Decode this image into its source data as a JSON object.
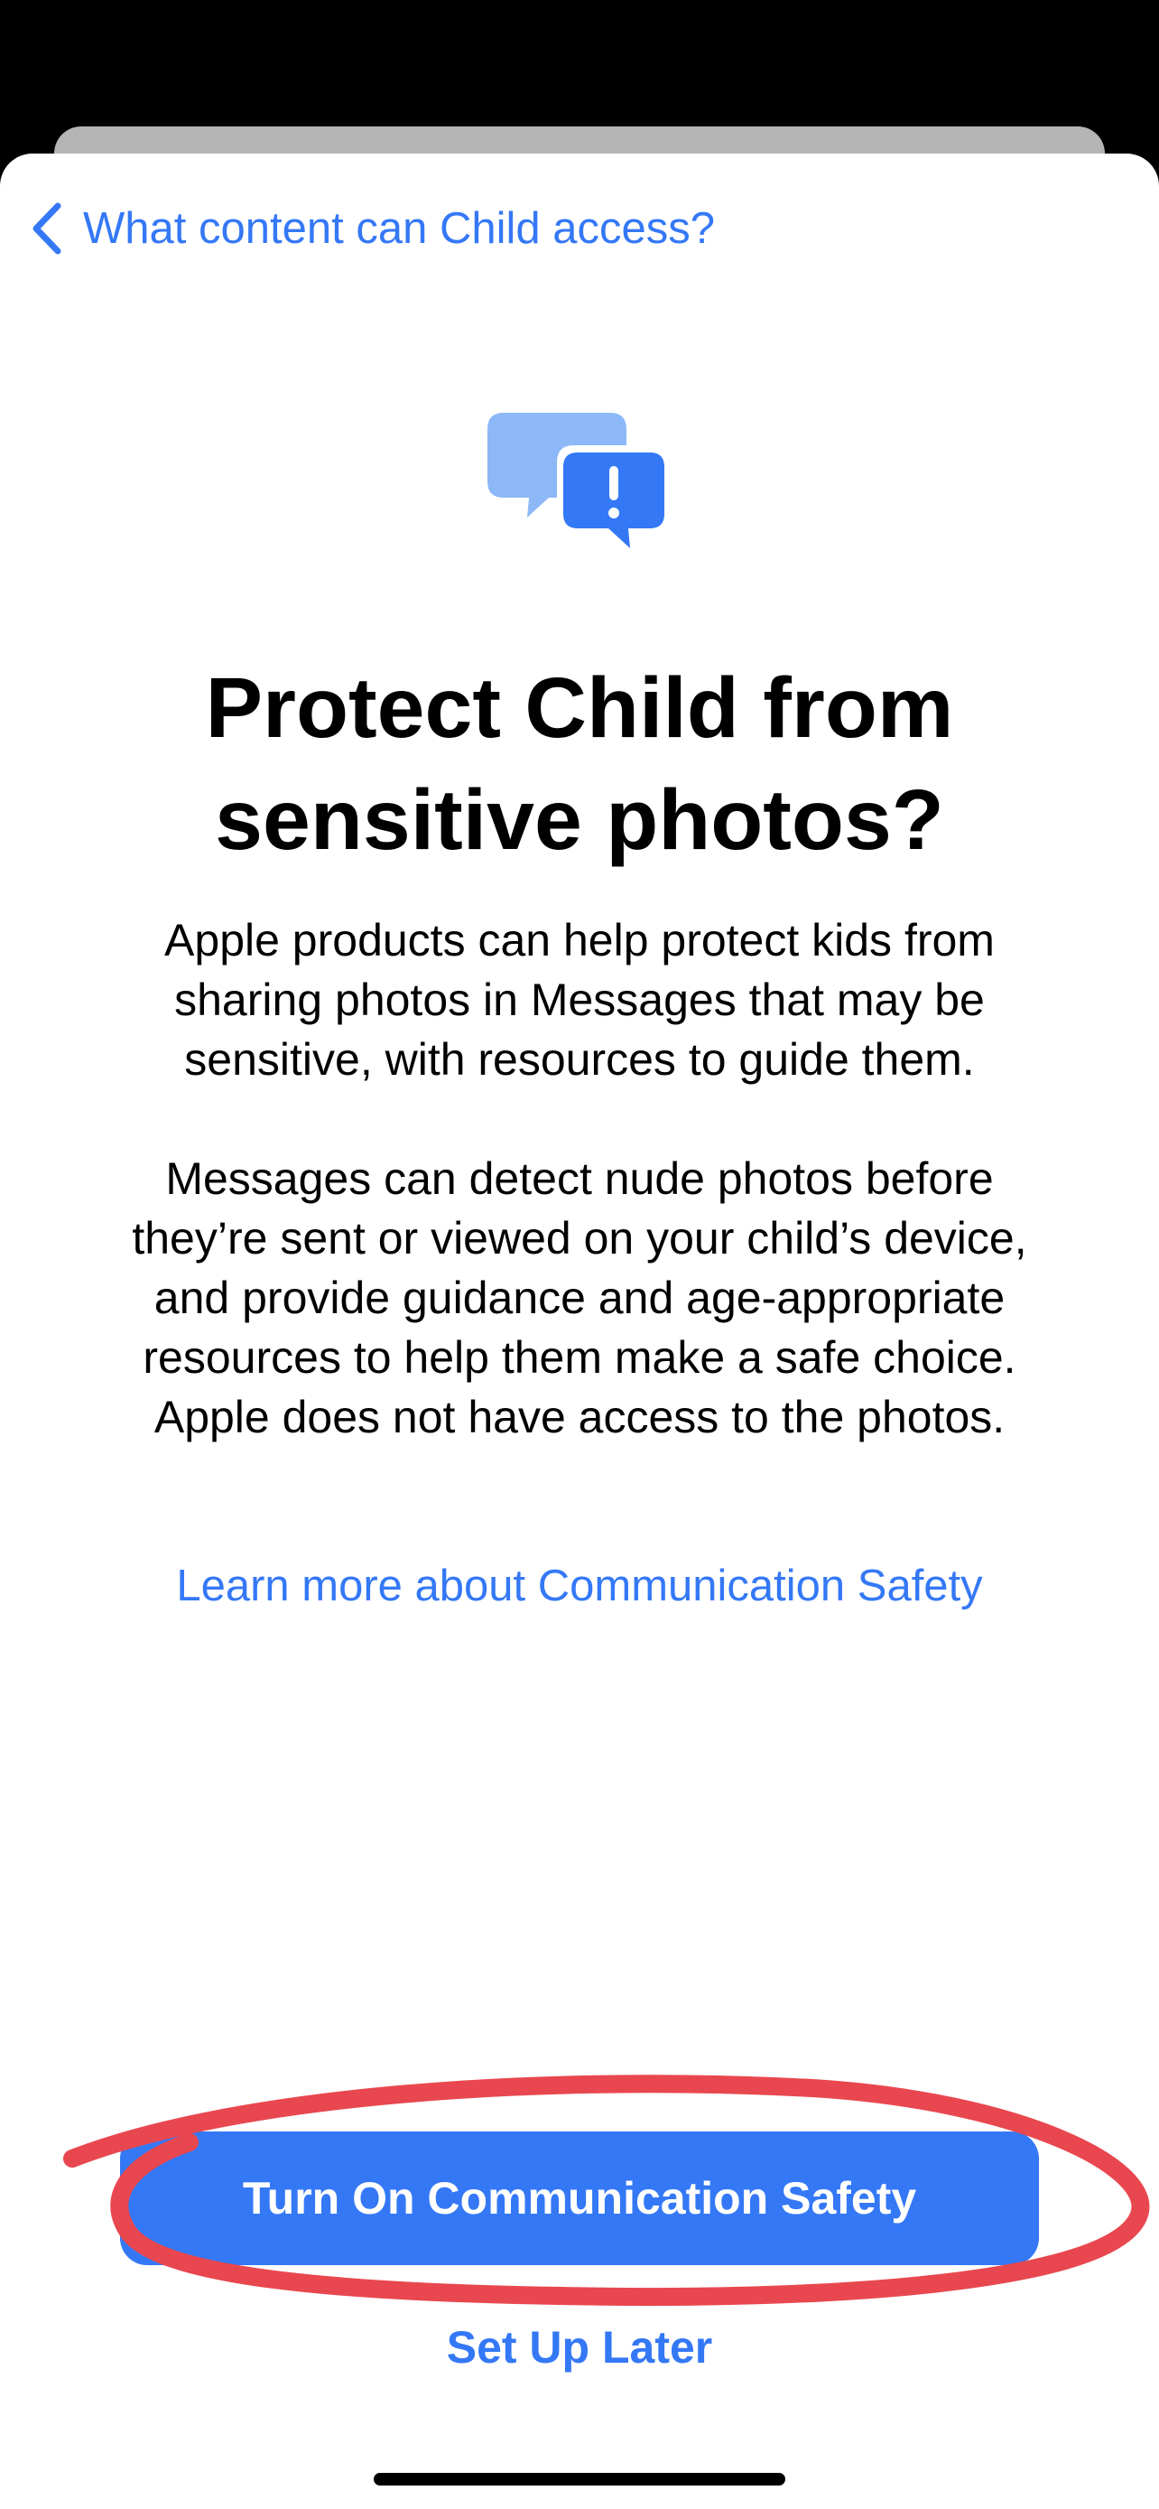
{
  "nav": {
    "back_label": "What content can Child access?"
  },
  "hero": {
    "icon": "chat-bubbles-exclamation-icon"
  },
  "title": "Protect Child from sensitive photos?",
  "body": {
    "paragraph1": "Apple products can help protect kids from sharing photos in Messages that may be sensitive, with resources to guide them.",
    "paragraph2": "Messages can detect nude photos before they’re sent or viewed on your child’s device, and provide guidance and age-appropriate resources to help them make a safe choice. Apple does not have access to the photos."
  },
  "learn_more_label": "Learn more about Communication Safety",
  "actions": {
    "primary_label": "Turn On Communication Safety",
    "secondary_label": "Set Up Later"
  },
  "colors": {
    "accent": "#3478f6",
    "annotation": "#e8474f",
    "icon_light": "#8cb8f7"
  }
}
